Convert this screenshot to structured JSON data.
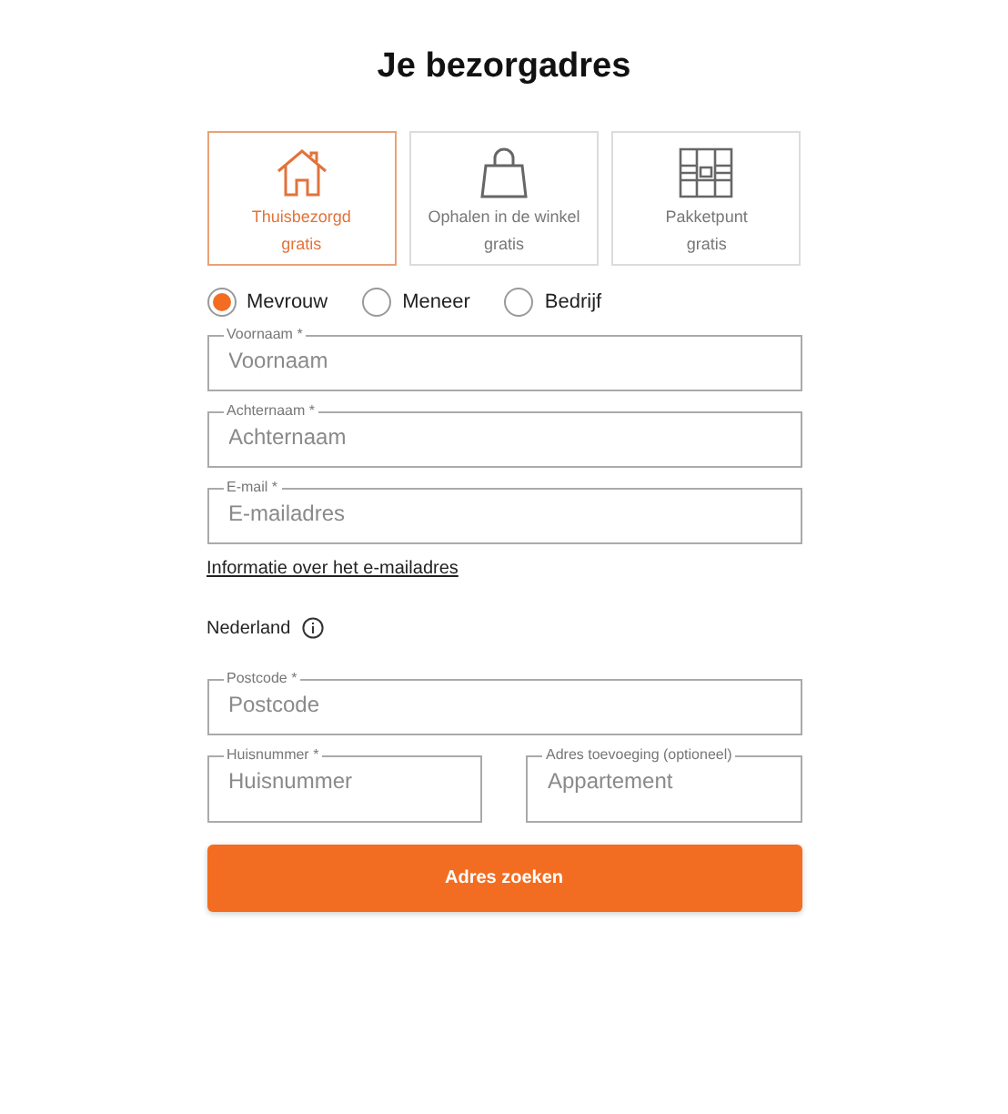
{
  "title": "Je bezorgadres",
  "delivery_options": [
    {
      "kind": "home",
      "label": "Thuisbezorgd",
      "price": "gratis",
      "selected": true
    },
    {
      "kind": "store",
      "label": "Ophalen in de winkel",
      "price": "gratis",
      "selected": false
    },
    {
      "kind": "locker",
      "label": "Pakketpunt",
      "price": "gratis",
      "selected": false
    }
  ],
  "salutation": [
    {
      "label": "Mevrouw",
      "selected": true
    },
    {
      "label": "Meneer",
      "selected": false
    },
    {
      "label": "Bedrijf",
      "selected": false
    }
  ],
  "fields_top": [
    {
      "label": "Voornaam *",
      "placeholder": "Voornaam"
    },
    {
      "label": "Achternaam *",
      "placeholder": "Achternaam"
    },
    {
      "label": "E-mail *",
      "placeholder": "E-mailadres"
    }
  ],
  "email_info_link": "Informatie over het e-mailadres",
  "country": "Nederland",
  "postcode": {
    "label": "Postcode *",
    "placeholder": "Postcode"
  },
  "address_row": [
    {
      "label": "Huisnummer *",
      "placeholder": "Huisnummer"
    },
    {
      "label": "Adres toevoeging (optioneel)",
      "placeholder": "Appartement"
    }
  ],
  "submit": "Adres zoeken"
}
